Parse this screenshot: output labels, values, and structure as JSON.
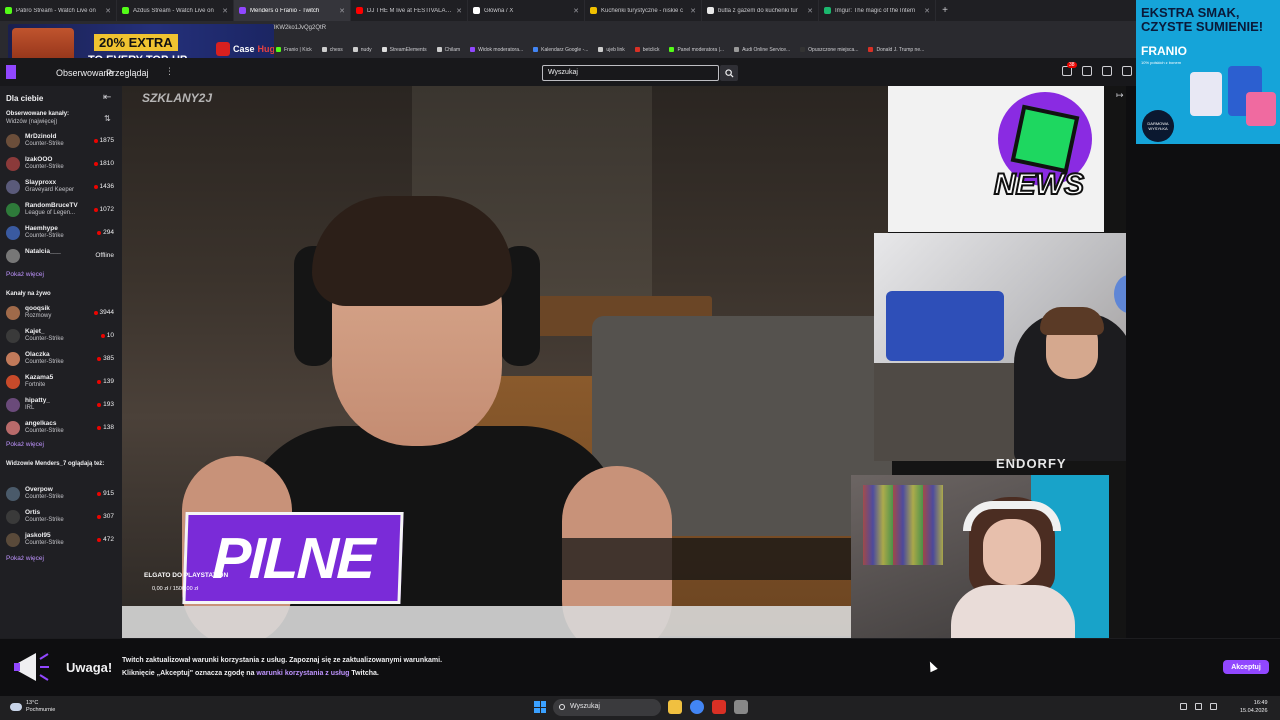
{
  "browser": {
    "tabs": [
      {
        "title": "Patiro Stream - Watch Live on",
        "color": "#53fc18"
      },
      {
        "title": "Azdus Stream - Watch Live on",
        "color": "#53fc18"
      },
      {
        "title": "Menders o Franio - Twitch",
        "color": "#9147ff",
        "active": true
      },
      {
        "title": "DJ THE M live at FESTIVALAND",
        "color": "#ff0000"
      },
      {
        "title": "Główna / X",
        "color": "#ffffff"
      },
      {
        "title": "Kuchenki turystyczne - niskie c",
        "color": "#f0c000"
      },
      {
        "title": "butla z gazem do kuchenki tur",
        "color": "#e8e8e8"
      },
      {
        "title": "Imgur: The magic of the Intern",
        "color": "#1bb76e"
      }
    ],
    "url": "8KW2ko1JvQg2QtR",
    "bookmarks": [
      "Franio | Kick",
      "chess",
      "nudy",
      "StreamElements",
      "Chilam",
      "Widok moderatora...",
      "Kalendarz Google -...",
      "ujeb link",
      "betclick",
      "Panel moderatora |...",
      "Audi Online Service...",
      "Opuszczone miejsca...",
      "Donald J. Trump ne..."
    ]
  },
  "ad_banner": {
    "line1": "20% EXTRA",
    "line2": "TO EVERY TOP-UP",
    "brand": "Case",
    "brand_accent": "Hug"
  },
  "side_ad": {
    "headline": "EKSTRA SMAK, CZYSTE SUMIENIE!",
    "brand": "FRANIO",
    "sub": "10% polskich z bonem",
    "badge": "DARMOWA WYSYŁKA"
  },
  "twitch": {
    "nav": {
      "following": "Obserwowane",
      "browse": "Przeglądaj"
    },
    "search_placeholder": "Wyszukaj",
    "notif_count": "38",
    "sidebar": {
      "title": "Dla ciebie",
      "followed_header": "Obserwowane kanały:",
      "followed_sort": "Widzów (najwięcej)",
      "followed": [
        {
          "name": "MrDzinold",
          "game": "Counter-Strike",
          "viewers": "1875",
          "color": "#6b4e3a"
        },
        {
          "name": "IzakOOO",
          "game": "Counter-Strike",
          "viewers": "1810",
          "color": "#8b3a3a"
        },
        {
          "name": "Slayproxx",
          "game": "Graveyard Keeper",
          "viewers": "1436",
          "color": "#5a5a7a"
        },
        {
          "name": "RandomBruceTV",
          "game": "League of Legen...",
          "viewers": "1072",
          "color": "#2e7a3a"
        },
        {
          "name": "Haemhype",
          "game": "Counter-Strike",
          "viewers": "294",
          "color": "#3a5aa0"
        },
        {
          "name": "Natalcia___",
          "game": "",
          "viewers": "Offline",
          "color": "#777777",
          "offline": true
        }
      ],
      "show_more": "Pokaż więcej",
      "live_header": "Kanały na żywo",
      "live": [
        {
          "name": "qooqsik",
          "game": "Rozmowy",
          "viewers": "3944",
          "color": "#a06a4a"
        },
        {
          "name": "Kajet_",
          "game": "Counter-Strike",
          "viewers": "10",
          "color": "#3a3a3a"
        },
        {
          "name": "Olaczka",
          "game": "Counter-Strike",
          "viewers": "385",
          "color": "#c27a5a"
        },
        {
          "name": "Kazama5",
          "game": "Fortnite",
          "viewers": "139",
          "color": "#c84a2a"
        },
        {
          "name": "hipatty_",
          "game": "IRL",
          "viewers": "193",
          "color": "#6a4a7a"
        },
        {
          "name": "angelkacs",
          "game": "Counter-Strike",
          "viewers": "138",
          "color": "#b86a6a"
        }
      ],
      "also_header": "Widzowie Menders_7 oglądają też:",
      "also": [
        {
          "name": "Overpow",
          "game": "Counter-Strike",
          "viewers": "915",
          "color": "#4a5a6a"
        },
        {
          "name": "Ortis",
          "game": "Counter-Strike",
          "viewers": "307",
          "color": "#3a3a3a"
        },
        {
          "name": "jaskol95",
          "game": "Counter-Strike",
          "viewers": "472",
          "color": "#5a4a3a"
        }
      ]
    },
    "stream": {
      "overlay_name": "SZKLANY2J",
      "pilne": "PILNE",
      "elgato": "ELGATO DO PLAYSTATION",
      "progress": "0,00 zł / 1500,00 zł",
      "news": "NEWS",
      "sponsor": "ENDORFY"
    },
    "notice": {
      "title": "Uwaga!",
      "line1": "Twitch zaktualizował warunki korzystania z usług. Zapoznaj się ze zaktualizowanymi warunkami.",
      "line2_a": "Kliknięcie „Akceptuj\" oznacza zgodę na ",
      "line2_link": "warunki korzystania z usług",
      "line2_b": " Twitcha.",
      "accept": "Akceptuj"
    }
  },
  "taskbar": {
    "temp": "13°C",
    "weather": "Pochmurnie",
    "search": "Wyszukaj",
    "time": "16:49",
    "date": "15.04.2026"
  }
}
